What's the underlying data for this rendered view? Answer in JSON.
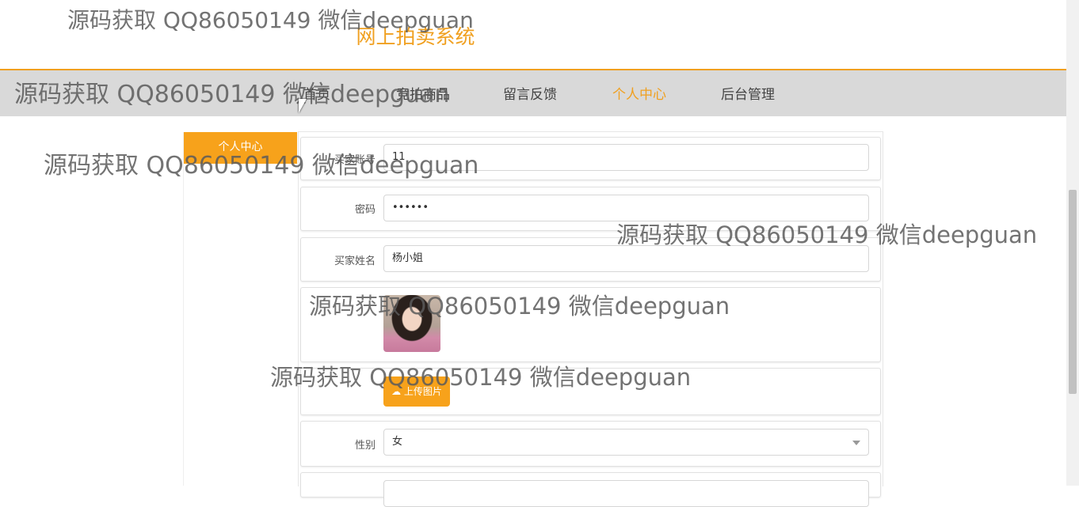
{
  "site": {
    "title": "网上拍卖系统"
  },
  "nav": {
    "items": [
      {
        "label": "首页",
        "active": false
      },
      {
        "label": "竞拍商品",
        "active": false
      },
      {
        "label": "留言反馈",
        "active": false
      },
      {
        "label": "个人中心",
        "active": true
      },
      {
        "label": "后台管理",
        "active": false
      }
    ]
  },
  "sidebar": {
    "tab": "个人中心"
  },
  "form": {
    "account": {
      "label": "买家账号",
      "value": "11"
    },
    "password": {
      "label": "密码",
      "value": "••••••"
    },
    "name": {
      "label": "买家姓名",
      "value": "杨小姐"
    },
    "upload": {
      "label": "上传图片",
      "icon": "cloud-upload-icon"
    },
    "gender": {
      "label": "性别",
      "value": "女"
    }
  },
  "watermark": "源码获取 QQ86050149 微信deepguan",
  "colors": {
    "accent": "#f7a21b",
    "nav_bg": "#d9d9d9"
  }
}
